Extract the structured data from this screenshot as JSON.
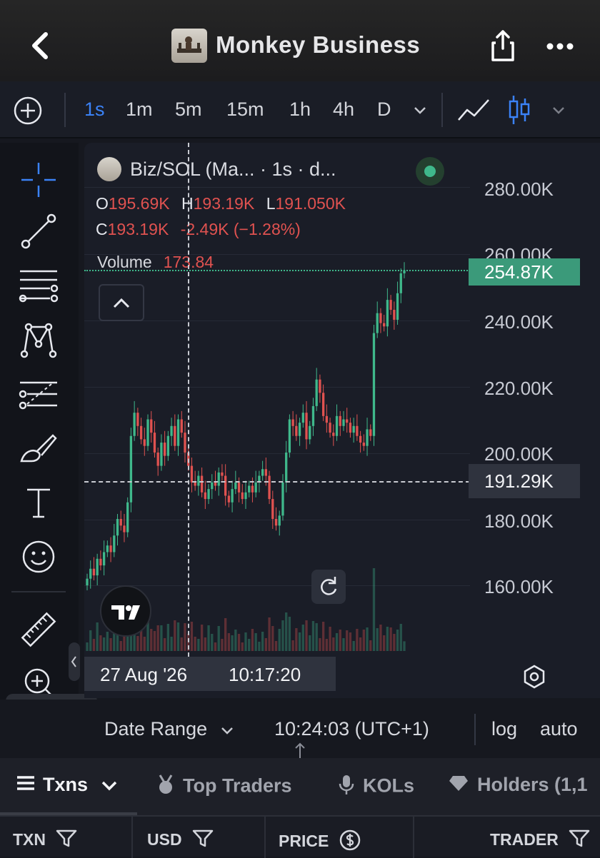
{
  "header": {
    "title": "Monkey Business"
  },
  "timeframes": {
    "items": [
      "1s",
      "1m",
      "5m",
      "15m",
      "1h",
      "4h",
      "D"
    ],
    "active": "1s"
  },
  "legend": {
    "symbol": "Biz/SOL (Ma... · 1s · d...",
    "o_label": "O",
    "o_value": "195.69K",
    "h_label": "H",
    "h_value": "193.19K",
    "l_label": "L",
    "l_value": "191.050K",
    "c_label": "C",
    "c_value": "193.19K",
    "change": "-2.49K (−1.28%)",
    "volume_label": "Volume",
    "volume_value": "173.84"
  },
  "price_axis": {
    "ticks": [
      "280.00K",
      "260.00K",
      "240.00K",
      "220.00K",
      "200.00K",
      "180.00K",
      "160.00K"
    ],
    "last_price": "254.87K",
    "crosshair_price": "191.29K"
  },
  "crosshair": {
    "date": "27 Aug '26",
    "time": "10:17:20"
  },
  "bottom_bar": {
    "date_range": "Date Range",
    "clock": "10:24:03 (UTC+1)",
    "log": "log",
    "auto": "auto"
  },
  "tabs": {
    "txns": "Txns",
    "top_traders": "Top Traders",
    "kols": "KOLs",
    "holders": "Holders (1,1"
  },
  "columns": {
    "txn": "TXN",
    "usd": "USD",
    "price": "PRICE",
    "trader": "TRADER"
  },
  "colors": {
    "accent": "#3b82f6",
    "up": "#3fb88b",
    "down": "#e05250",
    "last_price_bg": "#3b9a7a"
  },
  "chart_data": {
    "type": "candlestick",
    "ylim": [
      150,
      290
    ],
    "close": [
      162,
      165,
      163,
      168,
      166,
      170,
      172,
      170,
      175,
      180,
      178,
      176,
      185,
      205,
      212,
      208,
      204,
      202,
      210,
      206,
      200,
      196,
      203,
      199,
      205,
      208,
      202,
      210,
      206,
      200,
      196,
      191,
      190,
      193,
      188,
      186,
      189,
      191,
      190,
      194,
      193,
      187,
      185,
      189,
      191,
      188,
      186,
      188,
      190,
      188,
      191,
      193,
      195,
      193,
      186,
      180,
      178,
      181,
      191,
      200,
      210,
      208,
      205,
      209,
      212,
      204,
      208,
      214,
      222,
      218,
      211,
      209,
      206,
      205,
      211,
      208,
      210,
      209,
      206,
      208,
      205,
      203,
      202,
      207,
      205,
      236,
      242,
      239,
      238,
      246,
      243,
      240,
      248,
      254,
      254.87
    ],
    "volume_scale": "relative"
  }
}
